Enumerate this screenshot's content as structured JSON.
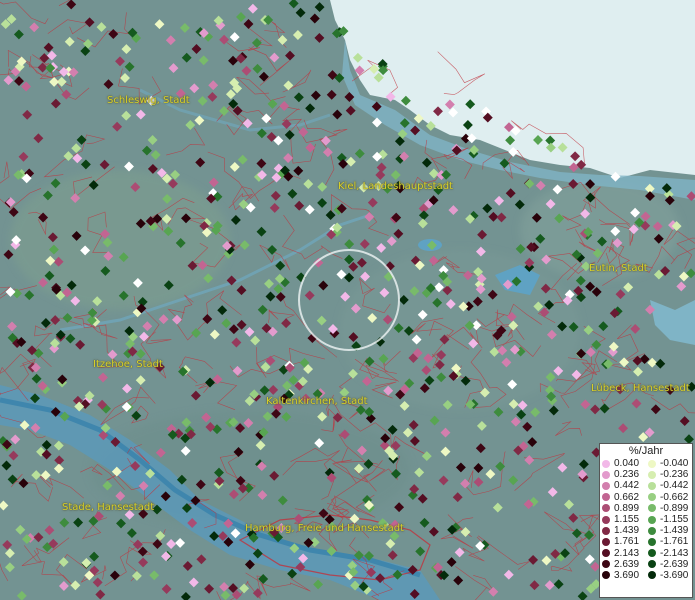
{
  "map": {
    "cities": [
      {
        "id": "schleswig",
        "label": "Schleswig, Stadt"
      },
      {
        "id": "kiel",
        "label": "Kiel, Landeshauptstadt"
      },
      {
        "id": "eutin",
        "label": "Eutin, Stadt"
      },
      {
        "id": "itzehoe",
        "label": "Itzehoe, Stadt"
      },
      {
        "id": "kaltenkirchen",
        "label": "Kaltenkirchen, Stadt"
      },
      {
        "id": "luebeck",
        "label": "Lübeck, Hansestadt"
      },
      {
        "id": "stade",
        "label": "Stade, Hansestadt"
      },
      {
        "id": "hamburg",
        "label": "Hamburg, Freie und Hansestadt"
      }
    ]
  },
  "legend": {
    "title": "%/Jahr",
    "positive": [
      {
        "value": "0.040",
        "color": "#f2b8e8"
      },
      {
        "value": "0.236",
        "color": "#e39bcd"
      },
      {
        "value": "0.442",
        "color": "#d37fae"
      },
      {
        "value": "0.662",
        "color": "#c26592"
      },
      {
        "value": "0.899",
        "color": "#ac4d74"
      },
      {
        "value": "1.155",
        "color": "#963a5c"
      },
      {
        "value": "1.439",
        "color": "#802945"
      },
      {
        "value": "1.761",
        "color": "#6a1a33"
      },
      {
        "value": "2.143",
        "color": "#540e22"
      },
      {
        "value": "2.639",
        "color": "#3e0614"
      },
      {
        "value": "3.690",
        "color": "#28020a"
      }
    ],
    "negative": [
      {
        "value": "-0.040",
        "color": "#eef8c4"
      },
      {
        "value": "-0.236",
        "color": "#d6eeb0"
      },
      {
        "value": "-0.442",
        "color": "#b8e09a"
      },
      {
        "value": "-0.662",
        "color": "#98cf82"
      },
      {
        "value": "-0.899",
        "color": "#78bb6a"
      },
      {
        "value": "-1.155",
        "color": "#58a552"
      },
      {
        "value": "-1.439",
        "color": "#3e8c3e"
      },
      {
        "value": "-1.761",
        "color": "#27732c"
      },
      {
        "value": "-2.143",
        "color": "#155a1e"
      },
      {
        "value": "-2.639",
        "color": "#0a4213"
      },
      {
        "value": "-3.690",
        "color": "#032a0a"
      }
    ]
  }
}
